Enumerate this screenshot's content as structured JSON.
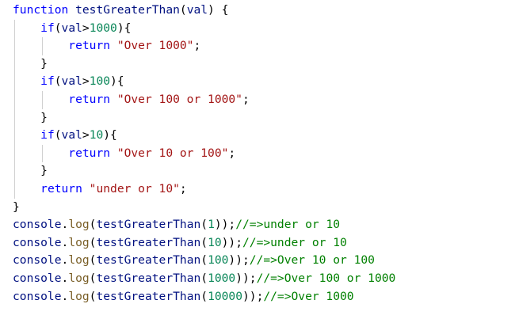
{
  "editor": {
    "lines": [
      [
        {
          "t": "function",
          "c": "kw"
        },
        {
          "t": " ",
          "c": "pn"
        },
        {
          "t": "testGreaterThan",
          "c": "id"
        },
        {
          "t": "(",
          "c": "pn"
        },
        {
          "t": "val",
          "c": "id"
        },
        {
          "t": ") {",
          "c": "pn"
        }
      ],
      [
        {
          "t": "    ",
          "c": "pn"
        },
        {
          "t": "if",
          "c": "kw"
        },
        {
          "t": "(",
          "c": "pn"
        },
        {
          "t": "val",
          "c": "id"
        },
        {
          "t": ">",
          "c": "pn"
        },
        {
          "t": "1000",
          "c": "num"
        },
        {
          "t": "){",
          "c": "pn"
        }
      ],
      [
        {
          "t": "        ",
          "c": "pn"
        },
        {
          "t": "return",
          "c": "kw"
        },
        {
          "t": " ",
          "c": "pn"
        },
        {
          "t": "\"Over 1000\"",
          "c": "str"
        },
        {
          "t": ";",
          "c": "pn"
        }
      ],
      [
        {
          "t": "    }",
          "c": "pn"
        }
      ],
      [
        {
          "t": "    ",
          "c": "pn"
        },
        {
          "t": "if",
          "c": "kw"
        },
        {
          "t": "(",
          "c": "pn"
        },
        {
          "t": "val",
          "c": "id"
        },
        {
          "t": ">",
          "c": "pn"
        },
        {
          "t": "100",
          "c": "num"
        },
        {
          "t": "){",
          "c": "pn"
        }
      ],
      [
        {
          "t": "        ",
          "c": "pn"
        },
        {
          "t": "return",
          "c": "kw"
        },
        {
          "t": " ",
          "c": "pn"
        },
        {
          "t": "\"Over 100 or 1000\"",
          "c": "str"
        },
        {
          "t": ";",
          "c": "pn"
        }
      ],
      [
        {
          "t": "    }",
          "c": "pn"
        }
      ],
      [
        {
          "t": "    ",
          "c": "pn"
        },
        {
          "t": "if",
          "c": "kw"
        },
        {
          "t": "(",
          "c": "pn"
        },
        {
          "t": "val",
          "c": "id"
        },
        {
          "t": ">",
          "c": "pn"
        },
        {
          "t": "10",
          "c": "num"
        },
        {
          "t": "){",
          "c": "pn"
        }
      ],
      [
        {
          "t": "        ",
          "c": "pn"
        },
        {
          "t": "return",
          "c": "kw"
        },
        {
          "t": " ",
          "c": "pn"
        },
        {
          "t": "\"Over 10 or 100\"",
          "c": "str"
        },
        {
          "t": ";",
          "c": "pn"
        }
      ],
      [
        {
          "t": "    }",
          "c": "pn"
        }
      ],
      [
        {
          "t": "    ",
          "c": "pn"
        },
        {
          "t": "return",
          "c": "kw"
        },
        {
          "t": " ",
          "c": "pn"
        },
        {
          "t": "\"under or 10\"",
          "c": "str"
        },
        {
          "t": ";",
          "c": "pn"
        }
      ],
      [
        {
          "t": "}",
          "c": "pn"
        }
      ],
      [
        {
          "t": "console",
          "c": "id"
        },
        {
          "t": ".",
          "c": "pn"
        },
        {
          "t": "log",
          "c": "fn"
        },
        {
          "t": "(",
          "c": "pn"
        },
        {
          "t": "testGreaterThan",
          "c": "id"
        },
        {
          "t": "(",
          "c": "pn"
        },
        {
          "t": "1",
          "c": "num"
        },
        {
          "t": "));",
          "c": "pn"
        },
        {
          "t": "//=>under or 10",
          "c": "cm"
        }
      ],
      [
        {
          "t": "console",
          "c": "id"
        },
        {
          "t": ".",
          "c": "pn"
        },
        {
          "t": "log",
          "c": "fn"
        },
        {
          "t": "(",
          "c": "pn"
        },
        {
          "t": "testGreaterThan",
          "c": "id"
        },
        {
          "t": "(",
          "c": "pn"
        },
        {
          "t": "10",
          "c": "num"
        },
        {
          "t": "));",
          "c": "pn"
        },
        {
          "t": "//=>under or 10",
          "c": "cm"
        }
      ],
      [
        {
          "t": "console",
          "c": "id"
        },
        {
          "t": ".",
          "c": "pn"
        },
        {
          "t": "log",
          "c": "fn"
        },
        {
          "t": "(",
          "c": "pn"
        },
        {
          "t": "testGreaterThan",
          "c": "id"
        },
        {
          "t": "(",
          "c": "pn"
        },
        {
          "t": "100",
          "c": "num"
        },
        {
          "t": "));",
          "c": "pn"
        },
        {
          "t": "//=>Over 10 or 100",
          "c": "cm"
        }
      ],
      [
        {
          "t": "console",
          "c": "id"
        },
        {
          "t": ".",
          "c": "pn"
        },
        {
          "t": "log",
          "c": "fn"
        },
        {
          "t": "(",
          "c": "pn"
        },
        {
          "t": "testGreaterThan",
          "c": "id"
        },
        {
          "t": "(",
          "c": "pn"
        },
        {
          "t": "1000",
          "c": "num"
        },
        {
          "t": "));",
          "c": "pn"
        },
        {
          "t": "//=>Over 100 or 1000",
          "c": "cm"
        }
      ],
      [
        {
          "t": "console",
          "c": "id"
        },
        {
          "t": ".",
          "c": "pn"
        },
        {
          "t": "log",
          "c": "fn"
        },
        {
          "t": "(",
          "c": "pn"
        },
        {
          "t": "testGreaterThan",
          "c": "id"
        },
        {
          "t": "(",
          "c": "pn"
        },
        {
          "t": "10000",
          "c": "num"
        },
        {
          "t": "));",
          "c": "pn"
        },
        {
          "t": "//=>Over 1000",
          "c": "cm"
        }
      ]
    ]
  },
  "colors": {
    "keyword": "#0000ff",
    "identifier": "#001080",
    "function": "#795e26",
    "number": "#098658",
    "string": "#a31515",
    "comment": "#008000",
    "indent_guide": "#d0d0d0",
    "background": "#ffffff"
  }
}
